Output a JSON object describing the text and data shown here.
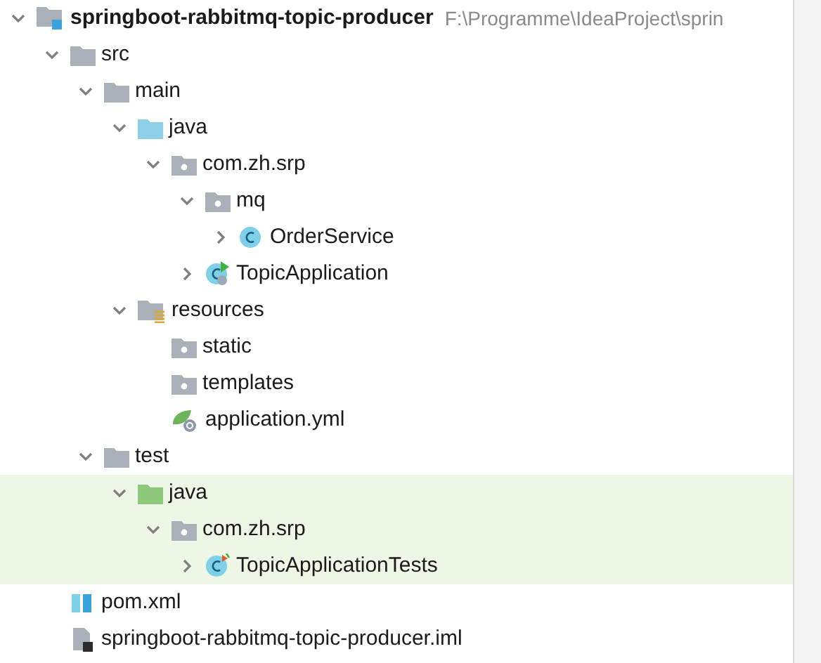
{
  "tree": [
    {
      "label": "springboot-rabbitmq-topic-producer",
      "kind": "module",
      "path": "F:\\Programme\\IdeaProject\\sprin",
      "expanded": true,
      "highlighted": false,
      "children": [
        {
          "label": "src",
          "kind": "folder",
          "expanded": true,
          "highlighted": false,
          "children": [
            {
              "label": "main",
              "kind": "folder",
              "expanded": true,
              "highlighted": false,
              "children": [
                {
                  "label": "java",
                  "kind": "source-folder",
                  "expanded": true,
                  "highlighted": false,
                  "children": [
                    {
                      "label": "com.zh.srp",
                      "kind": "package",
                      "expanded": true,
                      "highlighted": false,
                      "children": [
                        {
                          "label": "mq",
                          "kind": "package",
                          "expanded": true,
                          "highlighted": false,
                          "children": [
                            {
                              "label": "OrderService",
                              "kind": "class",
                              "expanded": false,
                              "highlighted": false
                            }
                          ]
                        },
                        {
                          "label": "TopicApplication",
                          "kind": "app-class",
                          "expanded": false,
                          "highlighted": false
                        }
                      ]
                    }
                  ]
                },
                {
                  "label": "resources",
                  "kind": "resources-folder",
                  "expanded": true,
                  "highlighted": false,
                  "children": [
                    {
                      "label": "static",
                      "kind": "package",
                      "highlighted": false
                    },
                    {
                      "label": "templates",
                      "kind": "package",
                      "highlighted": false
                    },
                    {
                      "label": "application.yml",
                      "kind": "yml",
                      "highlighted": false
                    }
                  ]
                }
              ]
            },
            {
              "label": "test",
              "kind": "folder",
              "expanded": true,
              "highlighted": false,
              "children": [
                {
                  "label": "java",
                  "kind": "test-folder",
                  "expanded": true,
                  "highlighted": true,
                  "children": [
                    {
                      "label": "com.zh.srp",
                      "kind": "package",
                      "expanded": true,
                      "highlighted": true,
                      "children": [
                        {
                          "label": "TopicApplicationTests",
                          "kind": "test-class",
                          "expanded": false,
                          "highlighted": true
                        }
                      ]
                    }
                  ]
                }
              ]
            }
          ]
        },
        {
          "label": "pom.xml",
          "kind": "xml",
          "highlighted": false
        },
        {
          "label": "springboot-rabbitmq-topic-producer.iml",
          "kind": "iml",
          "highlighted": false
        }
      ]
    }
  ]
}
